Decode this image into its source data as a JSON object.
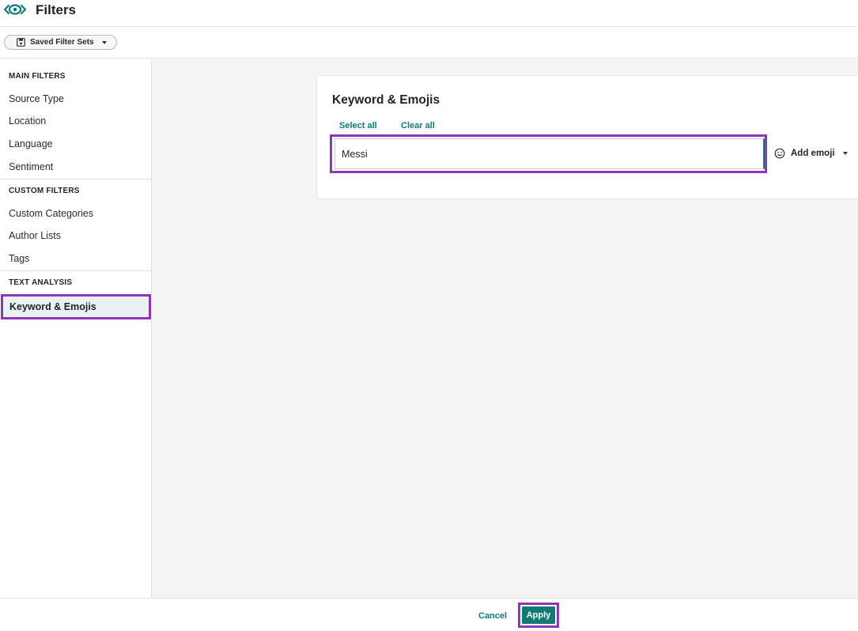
{
  "header": {
    "title": "Filters",
    "logo_icon": "eye-logo-icon",
    "accent": "#0f7b73"
  },
  "toolbar": {
    "saved_filter_sets_label": "Saved Filter Sets"
  },
  "sidebar": {
    "main_filters_title": "MAIN FILTERS",
    "main_items": [
      "Source Type",
      "Location",
      "Language",
      "Sentiment"
    ],
    "custom_filters_title": "CUSTOM FILTERS",
    "custom_items": [
      "Custom Categories",
      "Author Lists",
      "Tags"
    ],
    "text_analysis_title": "TEXT ANALYSIS",
    "active_item": "Keyword & Emojis"
  },
  "card": {
    "title": "Keyword & Emojis",
    "select_all": "Select all",
    "clear_all": "Clear all",
    "keyword_value": "Messi",
    "add_emoji": "Add emoji"
  },
  "footer": {
    "cancel": "Cancel",
    "apply": "Apply"
  },
  "colors": {
    "highlight": "#8e35b8",
    "teal": "#0f7b73"
  }
}
